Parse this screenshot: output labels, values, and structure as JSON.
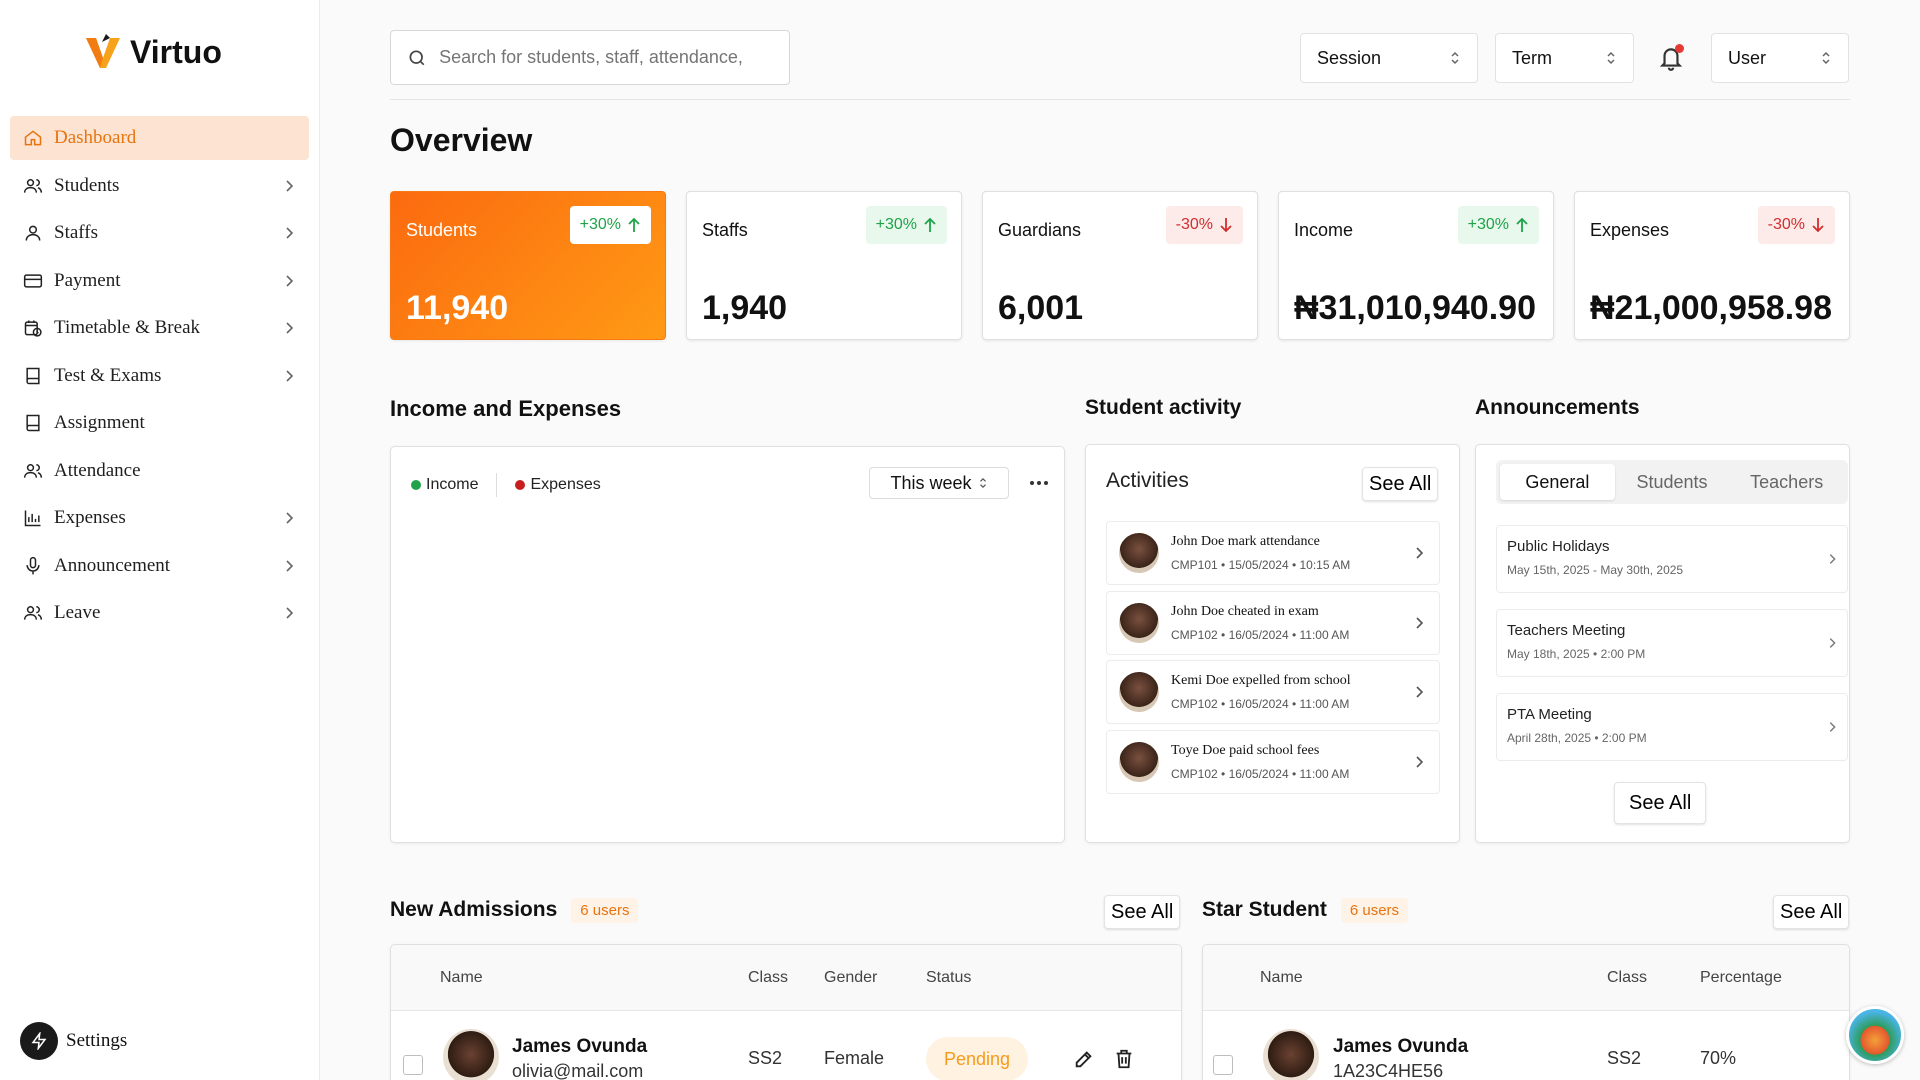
{
  "app": {
    "name": "Virtuo"
  },
  "sidebar": {
    "items": [
      {
        "label": "Dashboard",
        "icon": "home-icon",
        "active": true,
        "has_chevron": false
      },
      {
        "label": "Students",
        "icon": "users-icon",
        "active": false,
        "has_chevron": true
      },
      {
        "label": "Staffs",
        "icon": "user-icon",
        "active": false,
        "has_chevron": true
      },
      {
        "label": "Payment",
        "icon": "credit-card-icon",
        "active": false,
        "has_chevron": true
      },
      {
        "label": "Timetable & Break",
        "icon": "calendar-clock-icon",
        "active": false,
        "has_chevron": true
      },
      {
        "label": "Test & Exams",
        "icon": "book-icon",
        "active": false,
        "has_chevron": true
      },
      {
        "label": "Assignment",
        "icon": "book-icon",
        "active": false,
        "has_chevron": false
      },
      {
        "label": "Attendance",
        "icon": "users-icon",
        "active": false,
        "has_chevron": false
      },
      {
        "label": "Expenses",
        "icon": "bar-chart-icon",
        "active": false,
        "has_chevron": true
      },
      {
        "label": "Announcement",
        "icon": "microphone-icon",
        "active": false,
        "has_chevron": true
      },
      {
        "label": "Leave",
        "icon": "users-icon",
        "active": false,
        "has_chevron": true
      }
    ],
    "settings_label": "Settings"
  },
  "header": {
    "search_placeholder": "Search for students, staff, attendance,",
    "session_label": "Session",
    "term_label": "Term",
    "user_label": "User"
  },
  "overview": {
    "title": "Overview",
    "stats": [
      {
        "label": "Students",
        "value": "11,940",
        "change": "+30%",
        "trend": "up"
      },
      {
        "label": "Staffs",
        "value": "1,940",
        "change": "+30%",
        "trend": "up"
      },
      {
        "label": "Guardians",
        "value": "6,001",
        "change": "-30%",
        "trend": "down"
      },
      {
        "label": "Income",
        "value": "₦31,010,940.90",
        "change": "+30%",
        "trend": "up"
      },
      {
        "label": "Expenses",
        "value": "₦21,000,958.98",
        "change": "-30%",
        "trend": "down"
      }
    ]
  },
  "income_expenses": {
    "title": "Income and Expenses",
    "legend": [
      {
        "label": "Income",
        "color": "#22a24a"
      },
      {
        "label": "Expenses",
        "color": "#c81e1e"
      }
    ],
    "range_label": "This week"
  },
  "student_activity": {
    "title": "Student activity",
    "panel_title": "Activities",
    "see_all": "See All",
    "items": [
      {
        "title": "John Doe mark attendance",
        "code": "CMP101",
        "date": "15/05/2024",
        "time": "10:15 AM"
      },
      {
        "title": "John Doe cheated in exam",
        "code": "CMP102",
        "date": "16/05/2024",
        "time": "11:00 AM"
      },
      {
        "title": "Kemi Doe expelled from school",
        "code": "CMP102",
        "date": "16/05/2024",
        "time": "11:00 AM"
      },
      {
        "title": "Toye Doe paid school fees",
        "code": "CMP102",
        "date": "16/05/2024",
        "time": "11:00 AM"
      }
    ]
  },
  "announcements": {
    "title": "Announcements",
    "tabs": [
      "General",
      "Students",
      "Teachers"
    ],
    "active_tab": "General",
    "items": [
      {
        "title": "Public Holidays",
        "date": "May 15th, 2025 - May 30th, 2025"
      },
      {
        "title": "Teachers Meeting",
        "date": "May 18th, 2025 • 2:00 PM"
      },
      {
        "title": "PTA Meeting",
        "date": "April 28th, 2025 • 2:00 PM"
      }
    ],
    "see_all": "See All"
  },
  "new_admissions": {
    "title": "New Admissions",
    "count": "6 users",
    "see_all": "See All",
    "columns": [
      "Name",
      "Class",
      "Gender",
      "Status"
    ],
    "rows": [
      {
        "name": "James Ovunda",
        "email": "olivia@mail.com",
        "class": "SS2",
        "gender": "Female",
        "status": "Pending"
      }
    ]
  },
  "star_student": {
    "title": "Star Student",
    "count": "6 users",
    "see_all": "See All",
    "columns": [
      "Name",
      "Class",
      "Percentage"
    ],
    "rows": [
      {
        "name": "James Ovunda",
        "id": "1A23C4HE56",
        "class": "SS2",
        "percentage": "70%"
      }
    ]
  }
}
